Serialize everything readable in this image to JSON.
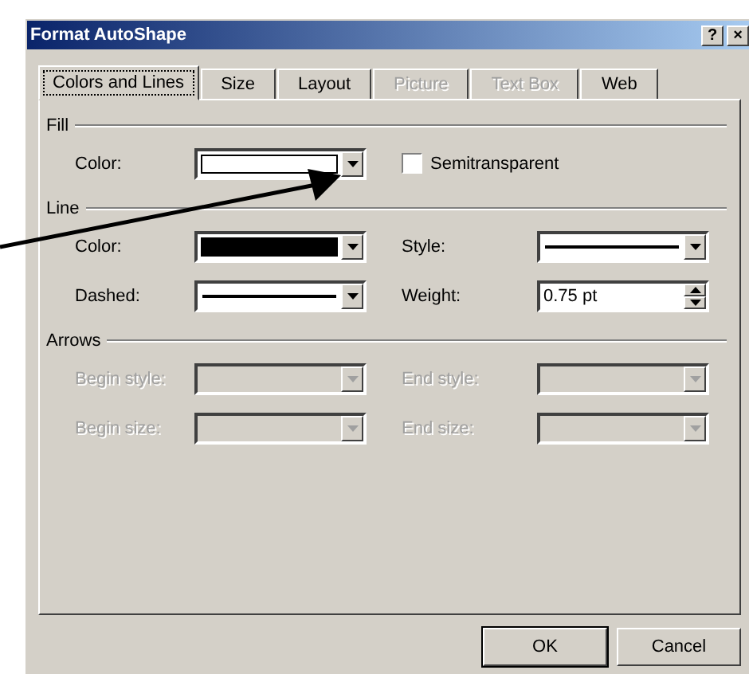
{
  "window": {
    "title": "Format AutoShape",
    "title_buttons": [
      "?",
      "×"
    ]
  },
  "tabs": [
    {
      "label": "Colors and Lines",
      "selected": true,
      "disabled": false
    },
    {
      "label": "Size",
      "selected": false,
      "disabled": false
    },
    {
      "label": "Layout",
      "selected": false,
      "disabled": false
    },
    {
      "label": "Picture",
      "selected": false,
      "disabled": true
    },
    {
      "label": "Text Box",
      "selected": false,
      "disabled": true
    },
    {
      "label": "Web",
      "selected": false,
      "disabled": false
    }
  ],
  "sections": [
    {
      "label": "Fill",
      "disabled": false,
      "fields": [
        {
          "label": "Color:",
          "kind": "color",
          "color": "#ffffff"
        },
        {
          "label": "Semitransparent",
          "kind": "checkbox",
          "checked": false
        }
      ]
    },
    {
      "label": "Line",
      "disabled": false,
      "fields": [
        {
          "label": "Color:",
          "kind": "color",
          "color": "#000000"
        },
        {
          "label": "Style:",
          "kind": "line"
        },
        {
          "label": "Dashed:",
          "kind": "line"
        },
        {
          "label": "Weight:",
          "kind": "spinner",
          "value": "0.75 pt"
        }
      ]
    },
    {
      "label": "Arrows",
      "disabled": true,
      "fields": [
        {
          "label": "Begin style:",
          "kind": "empty"
        },
        {
          "label": "End style:",
          "kind": "empty"
        },
        {
          "label": "Begin size:",
          "kind": "empty"
        },
        {
          "label": "End size:",
          "kind": "empty"
        }
      ]
    }
  ],
  "buttons": [
    {
      "label": "OK",
      "default": true
    },
    {
      "label": "Cancel",
      "default": false
    }
  ]
}
